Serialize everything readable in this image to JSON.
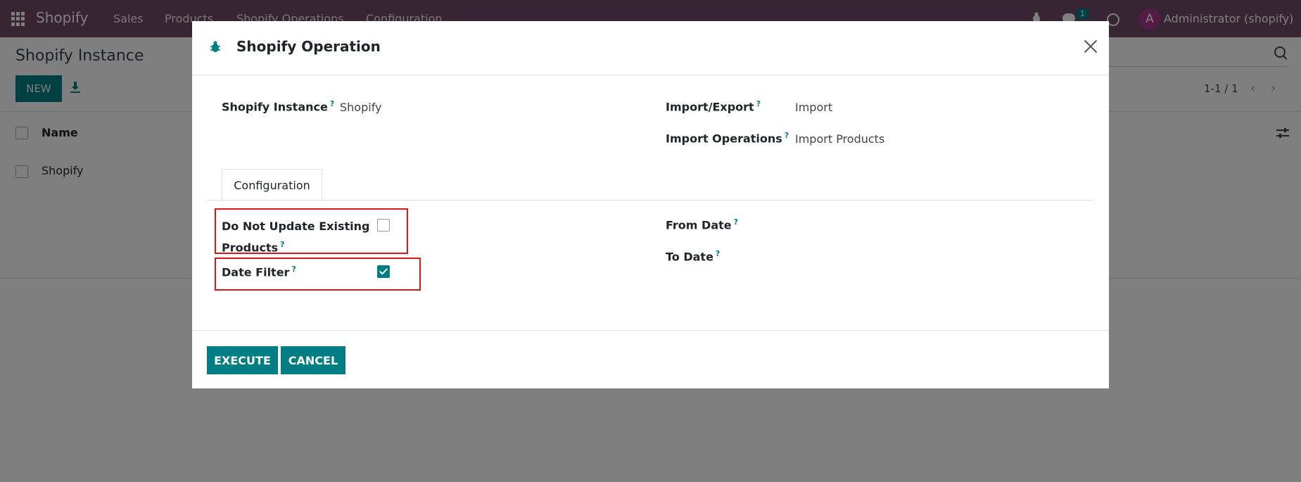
{
  "navbar": {
    "brand": "Shopify",
    "menu": [
      "Sales",
      "Products",
      "Shopify Operations",
      "Configuration"
    ],
    "chat_count": "1",
    "avatar_letter": "A",
    "user": "Administrator (shopify)"
  },
  "page": {
    "title": "Shopify Instance",
    "new_label": "NEW",
    "pager": "1-1 / 1"
  },
  "list": {
    "header_name": "Name",
    "rows": [
      "Shopify"
    ]
  },
  "modal": {
    "title": "Shopify Operation",
    "fields": {
      "instance_label": "Shopify Instance",
      "instance_value": "Shopify",
      "import_export_label": "Import/Export",
      "import_export_value": "Import",
      "import_operations_label": "Import Operations",
      "import_operations_value": "Import Products"
    },
    "tab_label": "Configuration",
    "config": {
      "do_not_update_line1": "Do Not Update Existing",
      "do_not_update_line2": "Products",
      "do_not_update_checked": false,
      "date_filter_label": "Date Filter",
      "date_filter_checked": true,
      "from_date_label": "From Date",
      "to_date_label": "To Date"
    },
    "help_mark": "?",
    "execute_label": "EXECUTE",
    "cancel_label": "CANCEL"
  },
  "colors": {
    "navbar": "#714B67",
    "primary": "#017e84",
    "highlight": "#e01515"
  },
  "icons": [
    "apps-grid-icon",
    "bug-icon",
    "chat-icon",
    "clock-icon",
    "download-icon",
    "search-icon",
    "chevron-left-icon",
    "chevron-right-icon",
    "column-settings-icon",
    "close-icon"
  ]
}
